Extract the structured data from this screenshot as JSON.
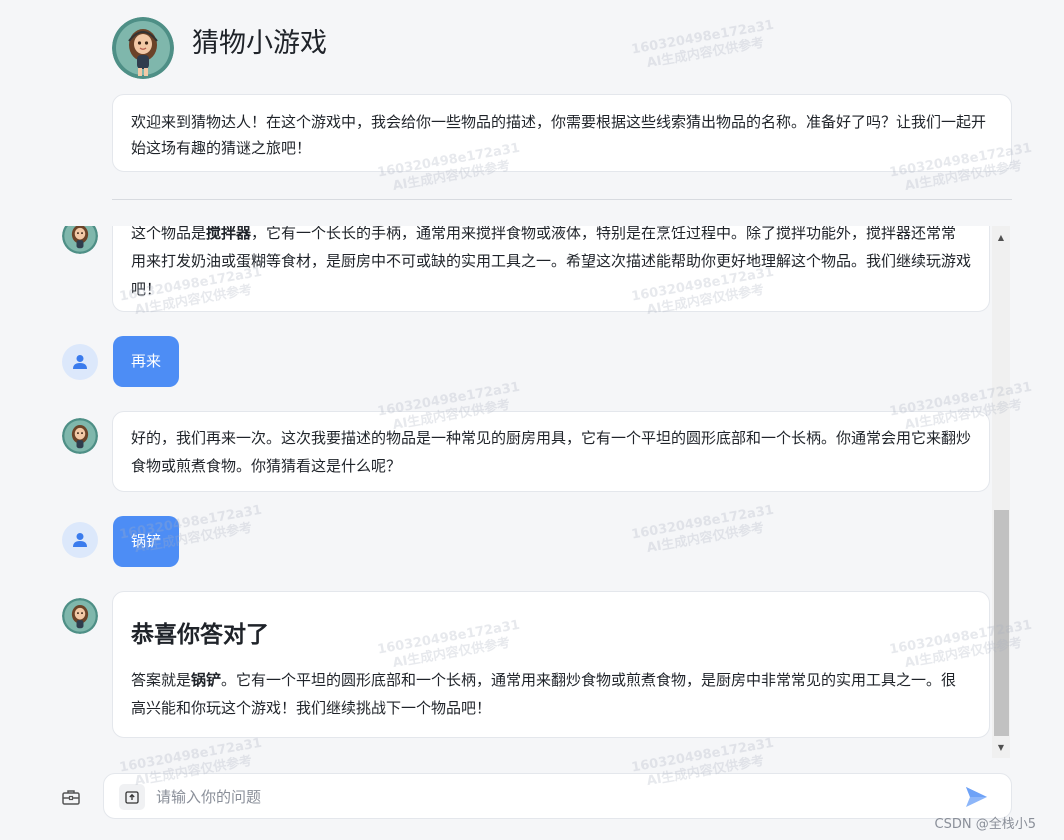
{
  "app": {
    "title": "猜物小游戏",
    "welcome_message": "欢迎来到猜物达人！在这个游戏中，我会给你一些物品的描述，你需要根据这些线索猜出物品的名称。准备好了吗？让我们一起开始这场有趣的猜谜之旅吧！"
  },
  "messages": [
    {
      "role": "bot",
      "pre": "这个物品是",
      "strong": "搅拌器",
      "post": "，它有一个长长的手柄，通常用来搅拌食物或液体，特别是在烹饪过程中。除了搅拌功能外，搅拌器还常常用来打发奶油或蛋糊等食材，是厨房中不可或缺的实用工具之一。希望这次描述能帮助你更好地理解这个物品。我们继续玩游戏吧！"
    },
    {
      "role": "user",
      "text": "再来"
    },
    {
      "role": "bot",
      "text": "好的，我们再来一次。这次我要描述的物品是一种常见的厨房用具，它有一个平坦的圆形底部和一个长柄。你通常会用它来翻炒食物或煎煮食物。你猜猜看这是什么呢？"
    },
    {
      "role": "user",
      "text": "锅铲"
    },
    {
      "role": "bot",
      "heading": "恭喜你答对了",
      "pre": "答案就是",
      "strong": "锅铲",
      "post": "。它有一个平坦的圆形底部和一个长柄，通常用来翻炒食物或煎煮食物，是厨房中非常常见的实用工具之一。很高兴能和你玩这个游戏！我们继续挑战下一个物品吧！"
    }
  ],
  "input": {
    "placeholder": "请输入你的问题",
    "value": ""
  },
  "footer": {
    "credit": "CSDN @全栈小5"
  },
  "watermark": {
    "line1": "160320498e172a31",
    "line2": "AI生成内容仅供参考"
  },
  "colors": {
    "accent": "#4d8df5",
    "user_avatar_bg": "#dce8fb",
    "page_bg": "#f5f6f8"
  },
  "icons": {
    "bot_avatar": "cartoon-girl-avatar-icon",
    "user_avatar": "person-icon",
    "tools": "toolbox-icon",
    "upload": "upload-file-icon",
    "send": "send-icon"
  }
}
